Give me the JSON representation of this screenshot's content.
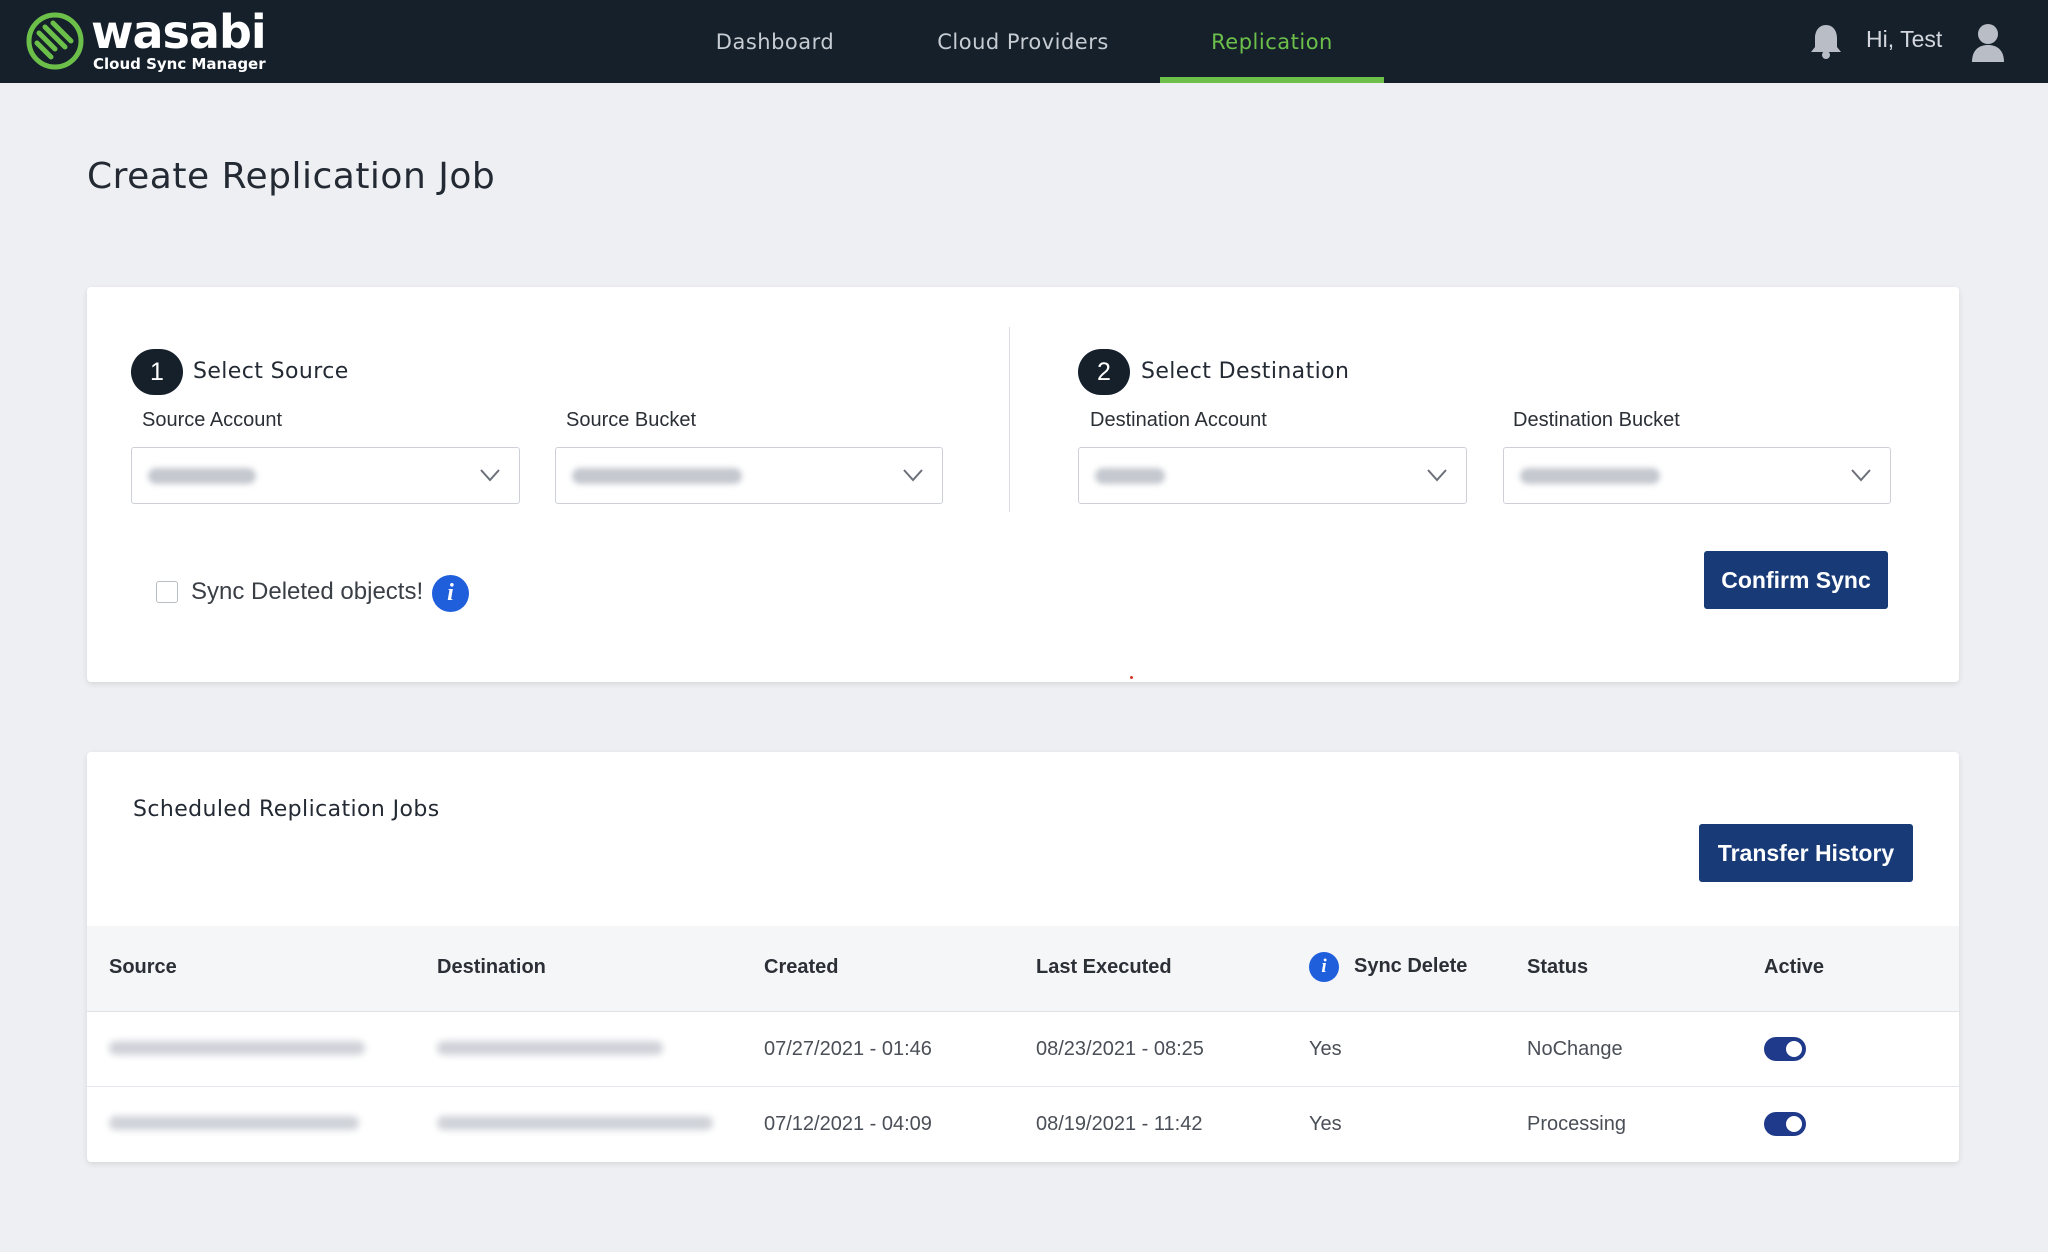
{
  "brand": {
    "name": "wasabi",
    "subtitle": "Cloud Sync Manager",
    "accent": "#6cc04a",
    "bar_color": "#15202b"
  },
  "nav": {
    "items": [
      {
        "label": "Dashboard",
        "active": false
      },
      {
        "label": "Cloud Providers",
        "active": false
      },
      {
        "label": "Replication",
        "active": true
      }
    ],
    "notifications_icon": "bell-icon",
    "greeting": "Hi, Test",
    "user_icon": "user-icon"
  },
  "page": {
    "title": "Create Replication Job"
  },
  "source": {
    "step": "1",
    "title": "Select Source",
    "account_label": "Source Account",
    "bucket_label": "Source Bucket"
  },
  "destination": {
    "step": "2",
    "title": "Select Destination",
    "account_label": "Destination Account",
    "bucket_label": "Destination Bucket"
  },
  "options": {
    "sync_deleted_label": "Sync Deleted objects!",
    "sync_deleted_checked": false,
    "info_glyph": "i"
  },
  "actions": {
    "confirm_label": "Confirm Sync",
    "button_color": "#183b78"
  },
  "jobs": {
    "title": "Scheduled Replication Jobs",
    "history_label": "Transfer History",
    "columns": {
      "source": "Source",
      "destination": "Destination",
      "created": "Created",
      "last_executed": "Last Executed",
      "sync_delete": "Sync Delete",
      "status": "Status",
      "active": "Active"
    },
    "rows": [
      {
        "created": "07/27/2021 - 01:46",
        "last_executed": "08/23/2021 - 08:25",
        "sync_delete": "Yes",
        "status": "NoChange",
        "active": true
      },
      {
        "created": "07/12/2021 - 04:09",
        "last_executed": "08/19/2021 - 11:42",
        "sync_delete": "Yes",
        "status": "Processing",
        "active": true
      }
    ]
  }
}
